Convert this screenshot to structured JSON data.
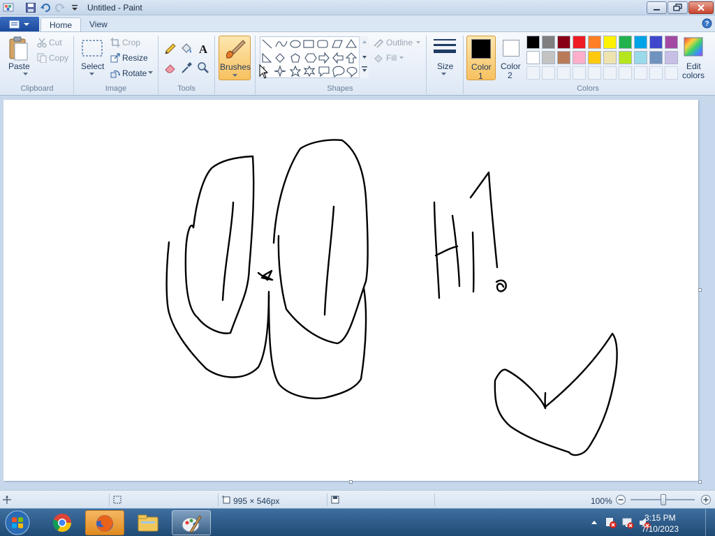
{
  "window": {
    "title": "Untitled - Paint"
  },
  "tabs": [
    {
      "label": "Home",
      "active": true
    },
    {
      "label": "View",
      "active": false
    }
  ],
  "ribbon": {
    "clipboard": {
      "paste": "Paste",
      "cut": "Cut",
      "copy": "Copy",
      "group": "Clipboard"
    },
    "image": {
      "select": "Select",
      "crop": "Crop",
      "resize": "Resize",
      "rotate": "Rotate",
      "group": "Image"
    },
    "tools": {
      "group": "Tools"
    },
    "brushes": {
      "label": "Brushes"
    },
    "shapes": {
      "outline": "Outline",
      "fill": "Fill",
      "group": "Shapes"
    },
    "size": {
      "label": "Size"
    },
    "colors": {
      "color1_line1": "Color",
      "color1_line2": "1",
      "color2_line1": "Color",
      "color2_line2": "2",
      "edit_line1": "Edit",
      "edit_line2": "colors",
      "group": "Colors",
      "color1_value": "#000000",
      "color2_value": "#ffffff",
      "palette_row1": [
        "#000000",
        "#7f7f7f",
        "#880015",
        "#ed1c24",
        "#ff7f27",
        "#fff200",
        "#22b14c",
        "#00a2e8",
        "#3f48cc",
        "#a349a4"
      ],
      "palette_row2": [
        "#ffffff",
        "#c3c3c3",
        "#b97a57",
        "#ffaec9",
        "#ffc90e",
        "#efe4b0",
        "#b5e61d",
        "#99d9ea",
        "#7092be",
        "#c8bfe7"
      ]
    }
  },
  "statusbar": {
    "dimensions": "995 × 546px",
    "zoom": "100%"
  },
  "taskbar": {
    "time": "3:15 PM",
    "date": "7/10/2023",
    "apps": [
      "chrome-icon",
      "firefox-icon",
      "explorer-icon",
      "paint-icon"
    ]
  },
  "accent_color": "#f7c160"
}
